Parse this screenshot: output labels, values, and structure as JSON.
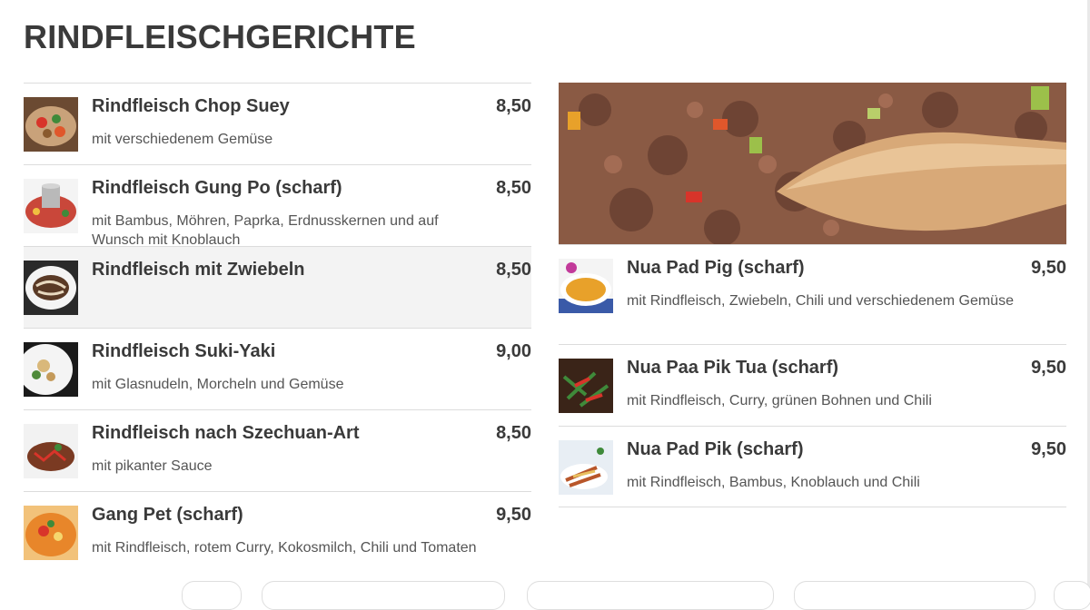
{
  "section": {
    "title": "RINDFLEISCHGERICHTE"
  },
  "left_items": [
    {
      "name": "Rindfleisch Chop Suey",
      "price": "8,50",
      "desc": "mit verschiedenem Gemüse",
      "image": "chop-suey-dish-image"
    },
    {
      "name": "Rindfleisch Gung Po (scharf)",
      "price": "8,50",
      "desc": "mit Bambus, Möhren, Paprka, Erdnusskernen und auf Wunsch mit Knoblauch",
      "image": "hot-pot-dish-image"
    },
    {
      "name": "Rindfleisch mit Zwiebeln",
      "price": "8,50",
      "desc": "",
      "image": "onion-beef-dish-image"
    },
    {
      "name": "Rindfleisch Suki-Yaki",
      "price": "9,00",
      "desc": "mit Glasnudeln, Morcheln und Gemüse",
      "image": "suki-yaki-dish-image"
    },
    {
      "name": "Rindfleisch nach Szechuan-Art",
      "price": "8,50",
      "desc": "mit pikanter Sauce",
      "image": "szechuan-dish-image"
    },
    {
      "name": "Gang Pet (scharf)",
      "price": "9,50",
      "desc": "mit Rindfleisch, rotem Curry, Kokosmilch, Chili und Tomaten",
      "image": "red-curry-dish-image"
    }
  ],
  "right_items": [
    {
      "name": "Nua Pad Pig (scharf)",
      "price": "9,50",
      "desc": "mit Rindfleisch, Zwiebeln, Chili und verschiedenem Gemüse",
      "image": "pad-pig-dish-image"
    },
    {
      "name": "Nua Paa Pik Tua (scharf)",
      "price": "9,50",
      "desc": "mit Rindfleisch, Curry, grünen Bohnen und Chili",
      "image": "green-beans-dish-image"
    },
    {
      "name": "Nua Pad Pik (scharf)",
      "price": "9,50",
      "desc": "mit Rindfleisch, Bambus, Knoblauch und Chili",
      "image": "bamboo-chili-dish-image"
    }
  ],
  "hero_image": "minced-beef-wooden-spoon-image",
  "colors": {
    "title": "#3a3a3a",
    "divider": "#dcdcdc",
    "highlight_row": "#f3f3f3",
    "description": "#555555"
  }
}
